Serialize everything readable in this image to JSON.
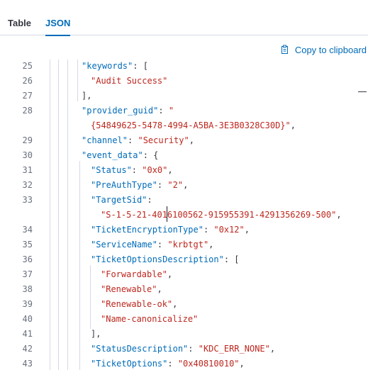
{
  "tabs": [
    {
      "label": "Table",
      "active": false
    },
    {
      "label": "JSON",
      "active": true
    }
  ],
  "toolbar": {
    "copy_label": "Copy to clipboard",
    "copy_icon": "clipboard-icon"
  },
  "colors": {
    "accent": "#006bb8",
    "key": "#006bb8",
    "string": "#bd271e",
    "text": "#343741",
    "line_number": "#69707d",
    "guide": "#d3dae6"
  },
  "code_lines": [
    {
      "num": "25",
      "tokens": [
        {
          "t": "\"keywords\"",
          "c": "k"
        },
        {
          "t": ": [",
          "c": "p"
        }
      ]
    },
    {
      "num": "26",
      "tokens": [
        {
          "t": "\"Audit Success\"",
          "c": "s"
        }
      ]
    },
    {
      "num": "27",
      "tokens": [
        {
          "t": "],",
          "c": "p"
        }
      ]
    },
    {
      "num": "28",
      "tokens": [
        {
          "t": "\"provider_guid\"",
          "c": "k"
        },
        {
          "t": ": ",
          "c": "p"
        },
        {
          "t": "\"",
          "c": "s"
        }
      ]
    },
    {
      "num": "",
      "tokens": [
        {
          "t": "{54849625-5478-4994-A5BA-3E3B0328C30D}\"",
          "c": "s"
        },
        {
          "t": ",",
          "c": "p"
        }
      ]
    },
    {
      "num": "29",
      "tokens": [
        {
          "t": "\"channel\"",
          "c": "k"
        },
        {
          "t": ": ",
          "c": "p"
        },
        {
          "t": "\"Security\"",
          "c": "s"
        },
        {
          "t": ",",
          "c": "p"
        }
      ]
    },
    {
      "num": "30",
      "tokens": [
        {
          "t": "\"event_data\"",
          "c": "k"
        },
        {
          "t": ": {",
          "c": "p"
        }
      ]
    },
    {
      "num": "31",
      "tokens": [
        {
          "t": "\"Status\"",
          "c": "k"
        },
        {
          "t": ": ",
          "c": "p"
        },
        {
          "t": "\"0x0\"",
          "c": "s"
        },
        {
          "t": ",",
          "c": "p"
        }
      ]
    },
    {
      "num": "32",
      "tokens": [
        {
          "t": "\"PreAuthType\"",
          "c": "k"
        },
        {
          "t": ": ",
          "c": "p"
        },
        {
          "t": "\"2\"",
          "c": "s"
        },
        {
          "t": ",",
          "c": "p"
        }
      ]
    },
    {
      "num": "33",
      "tokens": [
        {
          "t": "\"TargetSid\"",
          "c": "k"
        },
        {
          "t": ":",
          "c": "p"
        }
      ]
    },
    {
      "num": "",
      "tokens": [
        {
          "t": "\"S-1-5-21-4016100562-915955391-4291356269-500\"",
          "c": "s"
        },
        {
          "t": ",",
          "c": "p"
        }
      ]
    },
    {
      "num": "34",
      "tokens": [
        {
          "t": "\"TicketEncryptionType\"",
          "c": "k"
        },
        {
          "t": ": ",
          "c": "p"
        },
        {
          "t": "\"0x12\"",
          "c": "s"
        },
        {
          "t": ",",
          "c": "p"
        }
      ]
    },
    {
      "num": "35",
      "tokens": [
        {
          "t": "\"ServiceName\"",
          "c": "k"
        },
        {
          "t": ": ",
          "c": "p"
        },
        {
          "t": "\"krbtgt\"",
          "c": "s"
        },
        {
          "t": ",",
          "c": "p"
        }
      ]
    },
    {
      "num": "36",
      "tokens": [
        {
          "t": "\"TicketOptionsDescription\"",
          "c": "k"
        },
        {
          "t": ": [",
          "c": "p"
        }
      ]
    },
    {
      "num": "37",
      "tokens": [
        {
          "t": "\"Forwardable\"",
          "c": "s"
        },
        {
          "t": ",",
          "c": "p"
        }
      ]
    },
    {
      "num": "38",
      "tokens": [
        {
          "t": "\"Renewable\"",
          "c": "s"
        },
        {
          "t": ",",
          "c": "p"
        }
      ]
    },
    {
      "num": "39",
      "tokens": [
        {
          "t": "\"Renewable-ok\"",
          "c": "s"
        },
        {
          "t": ",",
          "c": "p"
        }
      ]
    },
    {
      "num": "40",
      "tokens": [
        {
          "t": "\"Name-canonicalize\"",
          "c": "s"
        }
      ]
    },
    {
      "num": "41",
      "tokens": [
        {
          "t": "],",
          "c": "p"
        }
      ]
    },
    {
      "num": "42",
      "tokens": [
        {
          "t": "\"StatusDescription\"",
          "c": "k"
        },
        {
          "t": ": ",
          "c": "p"
        },
        {
          "t": "\"KDC_ERR_NONE\"",
          "c": "s"
        },
        {
          "t": ",",
          "c": "p"
        }
      ]
    },
    {
      "num": "43",
      "tokens": [
        {
          "t": "\"TicketOptions\"",
          "c": "k"
        },
        {
          "t": ": ",
          "c": "p"
        },
        {
          "t": "\"0x40810010\"",
          "c": "s"
        },
        {
          "t": ",",
          "c": "p"
        }
      ]
    }
  ]
}
